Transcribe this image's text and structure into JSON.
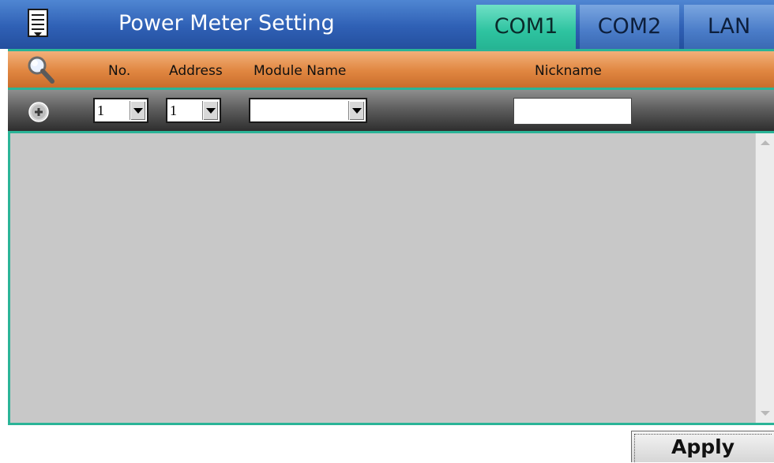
{
  "window": {
    "title": "Power Meter Setting",
    "menu_icon": "list-menu-icon"
  },
  "tabs": [
    {
      "label": "COM1",
      "active": true
    },
    {
      "label": "COM2",
      "active": false
    },
    {
      "label": "LAN",
      "active": false
    }
  ],
  "header": {
    "search_icon": "magnifier-icon",
    "columns": [
      "No.",
      "Address",
      "Module Name",
      "Nickname"
    ]
  },
  "add_row": {
    "add_icon": "plus-circle-icon",
    "no_value": "1",
    "address_value": "1",
    "module_name_value": "",
    "nickname_value": ""
  },
  "list": {
    "items": []
  },
  "footer": {
    "apply_label": "Apply"
  },
  "colors": {
    "title_bar": "#2f60b5",
    "active_tab": "#2ec3a0",
    "inactive_tab": "#4a7cc8",
    "header_bar": "#e08640",
    "accent_border": "#2bb497",
    "list_background": "#c8c8c8"
  }
}
